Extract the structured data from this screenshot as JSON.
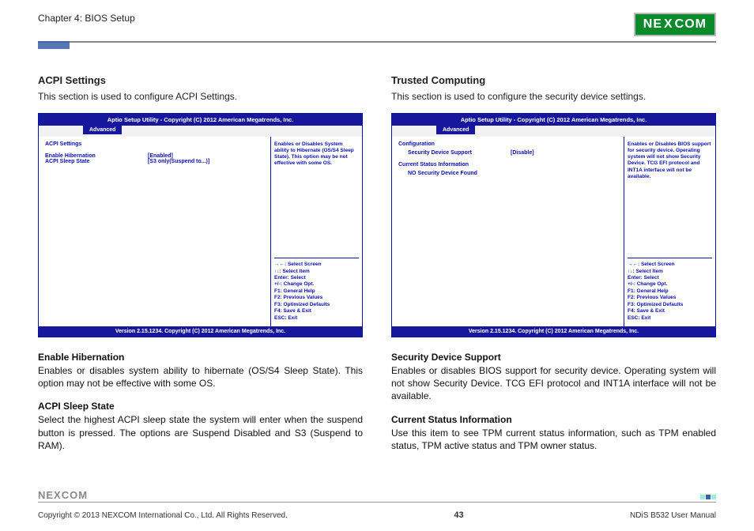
{
  "header": {
    "chapter": "Chapter 4: BIOS Setup",
    "logo_text": "NE COM",
    "logo_x": "X"
  },
  "left": {
    "title": "ACPI Settings",
    "desc": "This section is used to configure ACPI Settings.",
    "bios": {
      "titlebar": "Aptio Setup Utility - Copyright (C) 2012 American Megatrends, Inc.",
      "tab": "Advanced",
      "heading": "ACPI Settings",
      "rows": [
        {
          "label": "Enable Hibernation",
          "value": "[Enabled]"
        },
        {
          "label": "ACPI Sleep State",
          "value": "[S3 only(Suspend to...)]"
        }
      ],
      "help": "Enables or Disables System ability to Hibernate (OS/S4 Sleep State). This option may be not effective with some OS.",
      "keys": [
        "→←: Select Screen",
        "↑↓: Select Item",
        "Enter: Select",
        "+/-: Change Opt.",
        "F1: General Help",
        "F2: Previous Values",
        "F3: Optimized Defaults",
        "F4: Save & Exit",
        "ESC: Exit"
      ],
      "footer": "Version 2.15.1234. Copyright (C) 2012 American Megatrends, Inc."
    },
    "sub1_head": "Enable Hibernation",
    "sub1_body": "Enables or disables system ability to hibernate (OS/S4 Sleep State). This option may not be effective with some OS.",
    "sub2_head": "ACPI Sleep State",
    "sub2_body": "Select the highest ACPI sleep state the system will enter when the suspend button is pressed. The options are Suspend Disabled and S3 (Suspend to RAM)."
  },
  "right": {
    "title": "Trusted Computing",
    "desc": "This section is used to configure the security device settings.",
    "bios": {
      "titlebar": "Aptio Setup Utility - Copyright (C) 2012 American Megatrends, Inc.",
      "tab": "Advanced",
      "heading": "Configuration",
      "rows": [
        {
          "label": "Security Device Support",
          "value": "[Disable]"
        }
      ],
      "heading2": "Current Status Information",
      "rows2": [
        {
          "label": "NO Security Device Found",
          "value": ""
        }
      ],
      "help": "Enables or Disables BIOS support for security device. Operating system will not show Security Device. TCG EFI protocol and INT1A interface will not be available.",
      "keys": [
        "→←: Select Screen",
        "↑↓: Select Item",
        "Enter: Select",
        "+/-: Change Opt.",
        "F1: General Help",
        "F2: Previous Values",
        "F3: Optimized Defaults",
        "F4: Save & Exit",
        "ESC: Exit"
      ],
      "footer": "Version 2.15.1234. Copyright (C) 2012 American Megatrends, Inc."
    },
    "sub1_head": "Security Device Support",
    "sub1_body": "Enables or disables BIOS support for security device. Operating system will not show Security Device. TCG EFI protocol and INT1A interface will not be available.",
    "sub2_head": "Current Status Information",
    "sub2_body": "Use this item to see TPM current status information, such as TPM enabled status, TPM active status and TPM owner status."
  },
  "footer": {
    "logo": "NEXCOM",
    "copyright": "Copyright © 2013 NEXCOM International Co., Ltd. All Rights Reserved.",
    "page": "43",
    "manual": "NDiS B532 User Manual"
  }
}
